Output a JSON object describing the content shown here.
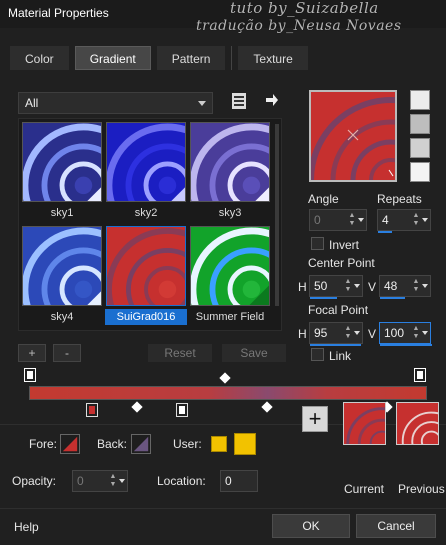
{
  "window": {
    "title": "Material Properties"
  },
  "watermark": {
    "line1": "tuto by_Suizabella",
    "line2": "tradução by_Neusa Novaes"
  },
  "tabs": [
    "Color",
    "Gradient",
    "Pattern",
    "Texture"
  ],
  "active_tab": "Gradient",
  "category": {
    "selected": "All"
  },
  "gallery": {
    "items": [
      {
        "label": "sky1"
      },
      {
        "label": "sky2"
      },
      {
        "label": "sky3"
      },
      {
        "label": "sky4"
      },
      {
        "label": "SuiGrad016",
        "selected": true
      },
      {
        "label": "Summer Field"
      }
    ]
  },
  "gallery_buttons": {
    "add": "+",
    "remove": "-",
    "reset": "Reset",
    "save": "Save"
  },
  "settings": {
    "angle_label": "Angle",
    "angle_value": "0",
    "repeats_label": "Repeats",
    "repeats_value": "4",
    "invert_label": "Invert",
    "center_point_label": "Center Point",
    "center_h_label": "H",
    "center_h_value": "50",
    "center_v_label": "V",
    "center_v_value": "48",
    "focal_point_label": "Focal Point",
    "focal_h_label": "H",
    "focal_h_value": "95",
    "focal_v_label": "V",
    "focal_v_value": "100",
    "link_label": "Link"
  },
  "bottom_panel": {
    "fore_label": "Fore:",
    "back_label": "Back:",
    "user_label": "User:",
    "opacity_label": "Opacity:",
    "opacity_value": "0",
    "location_label": "Location:",
    "location_value": "0",
    "current_label": "Current",
    "previous_label": "Previous"
  },
  "footer": {
    "help": "Help",
    "ok": "OK",
    "cancel": "Cancel"
  },
  "colors": {
    "accent": "#1a6fd0",
    "gradient_red": "#c6302f",
    "user_swatch": "#f2c200"
  }
}
